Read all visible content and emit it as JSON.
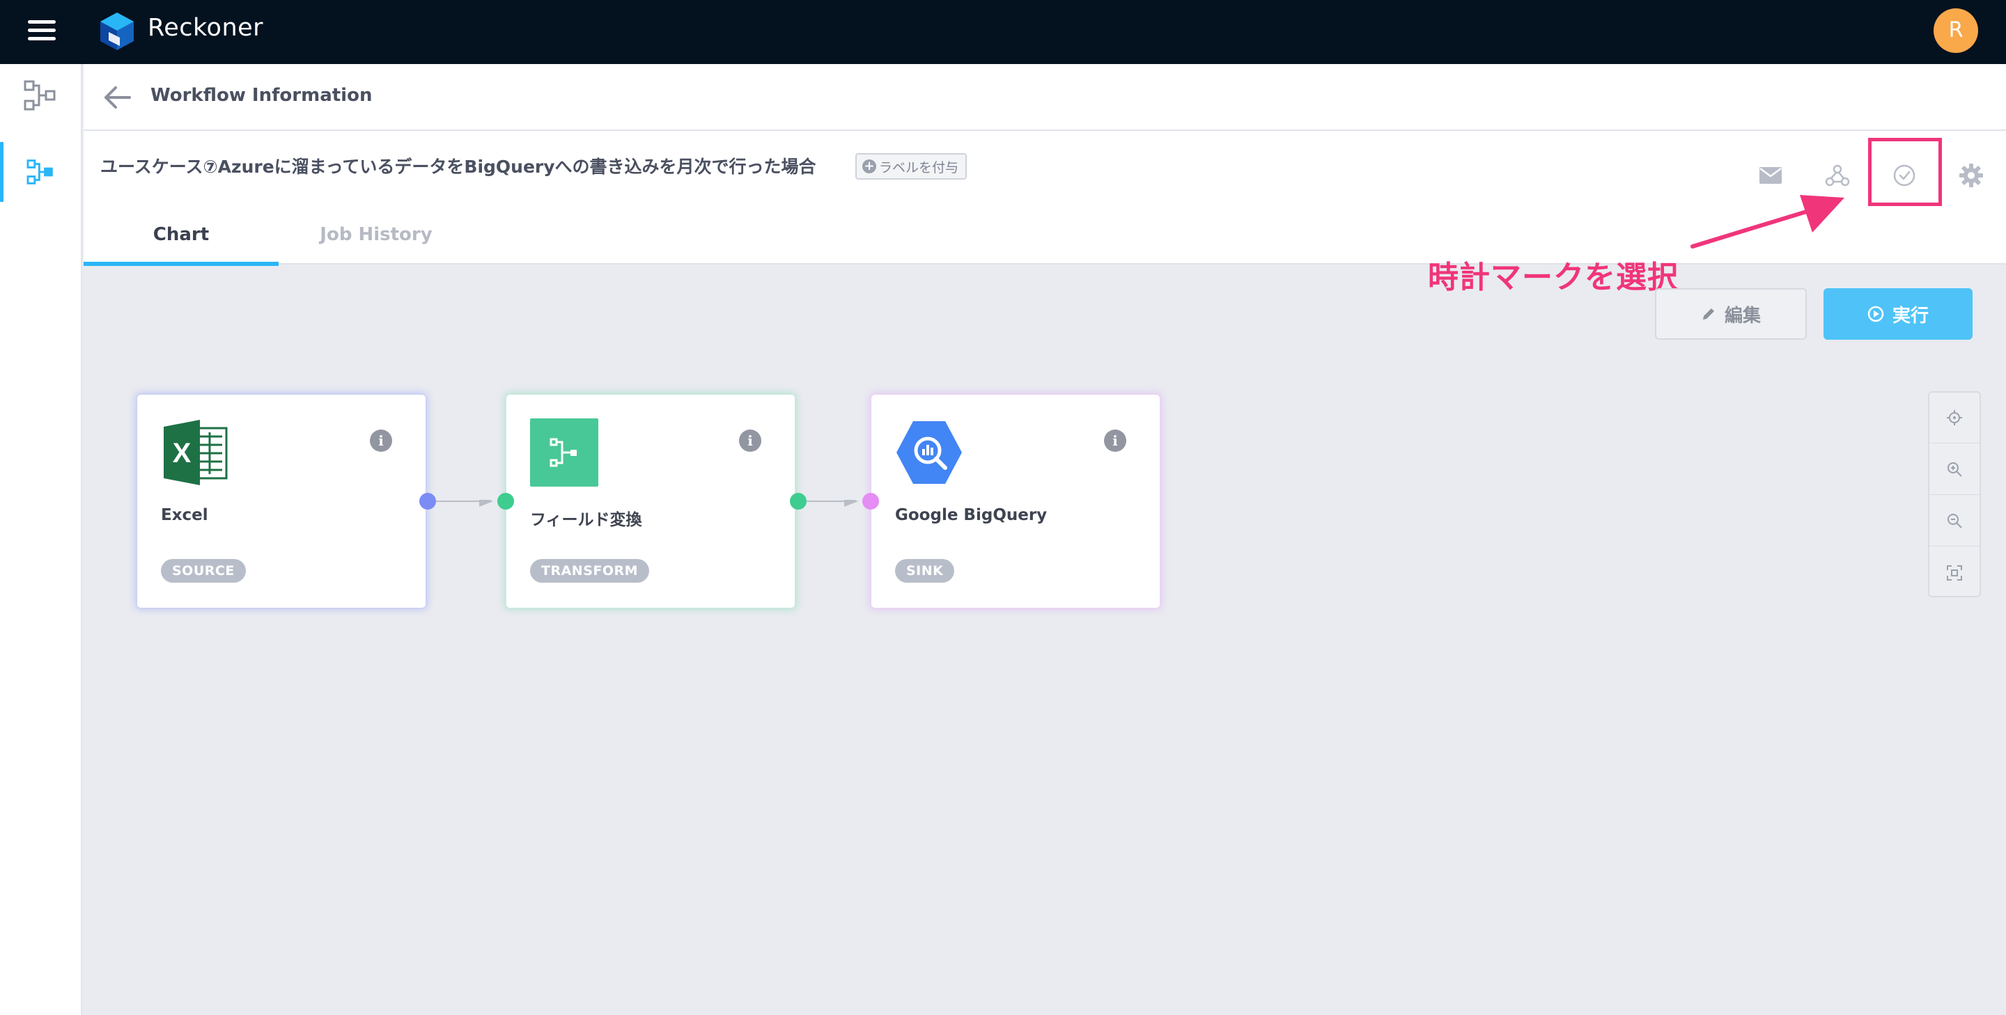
{
  "app": {
    "title": "Reckoner",
    "user_initial": "R"
  },
  "header": {
    "page_title": "Workflow Information"
  },
  "workflow": {
    "name": "ユースケース⑦Azureに溜まっているデータをBigQueryへの書き込みを月次で行った場合",
    "add_label": "ラベルを付与"
  },
  "tabs": [
    {
      "label": "Chart",
      "active": true
    },
    {
      "label": "Job History",
      "active": false
    }
  ],
  "header_icons": [
    "mail-icon",
    "webhook-icon",
    "clock-icon",
    "gear-icon"
  ],
  "annotation": {
    "text": "時計マークを選択",
    "color": "#f0357b"
  },
  "actions": {
    "edit_label": "編集",
    "run_label": "実行"
  },
  "nodes": [
    {
      "label": "Excel",
      "type": "SOURCE",
      "icon": "excel-icon",
      "port_color": "#7b8cf5"
    },
    {
      "label": "フィールド変換",
      "type": "TRANSFORM",
      "icon": "transform-icon",
      "port_color": "#3fcc8f"
    },
    {
      "label": "Google BigQuery",
      "type": "SINK",
      "icon": "bigquery-icon",
      "port_color": "#e58cf5"
    }
  ],
  "zoom_tools": [
    "center-icon",
    "zoom-in-icon",
    "zoom-out-icon",
    "fit-icon"
  ],
  "colors": {
    "topbar": "#04111f",
    "accent": "#29b6f6",
    "run_button": "#4fc3f7",
    "avatar": "#f9a84a",
    "highlight": "#f0357b"
  }
}
